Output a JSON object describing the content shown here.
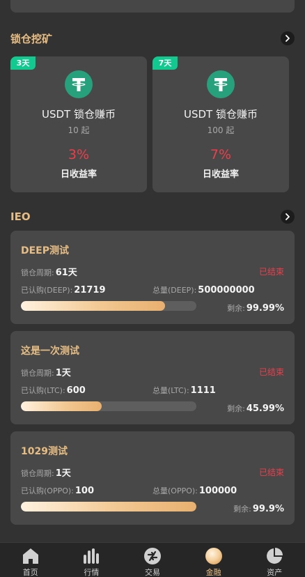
{
  "mining": {
    "title": "锁仓挖矿",
    "cards": [
      {
        "tag": "3天",
        "name": "USDT 锁仓赚币",
        "min": "10 起",
        "rate": "3%",
        "rate_label": "日收益率"
      },
      {
        "tag": "7天",
        "name": "USDT 锁仓赚币",
        "min": "100 起",
        "rate": "7%",
        "rate_label": "日收益率"
      }
    ]
  },
  "ieo": {
    "title": "IEO",
    "items": [
      {
        "name": "DEEP测试",
        "period_label": "锁仓周期:",
        "period": "61天",
        "status": "已结束",
        "subscribed_label": "已认购(DEEP):",
        "subscribed": "21719",
        "total_label": "总量(DEEP):",
        "total": "500000000",
        "remain_label": "剩余:",
        "remain": "99.99%",
        "progress": 0.82
      },
      {
        "name": "这是一次测试",
        "period_label": "锁仓周期:",
        "period": "1天",
        "status": "已结束",
        "subscribed_label": "已认购(LTC):",
        "subscribed": "600",
        "total_label": "总量(LTC):",
        "total": "1111",
        "remain_label": "剩余:",
        "remain": "45.99%",
        "progress": 0.46
      },
      {
        "name": "1029测试",
        "period_label": "锁仓周期:",
        "period": "1天",
        "status": "已结束",
        "subscribed_label": "已认购(OPPO):",
        "subscribed": "100",
        "total_label": "总量(OPPO):",
        "total": "100000",
        "remain_label": "剩余:",
        "remain": "99.9%",
        "progress": 1.0
      }
    ]
  },
  "tabbar": {
    "items": [
      {
        "label": "首页",
        "icon": "home-icon"
      },
      {
        "label": "行情",
        "icon": "market-bars-icon"
      },
      {
        "label": "交易",
        "icon": "trade-icon"
      },
      {
        "label": "金融",
        "icon": "finance-coin-icon",
        "active": true
      },
      {
        "label": "资产",
        "icon": "asset-pie-icon"
      }
    ]
  },
  "colors": {
    "accent_gold": "#e6bd84",
    "tag_green": "#12c98f",
    "rate_red": "#ec3e4b",
    "usdt_green": "#26a17b"
  }
}
